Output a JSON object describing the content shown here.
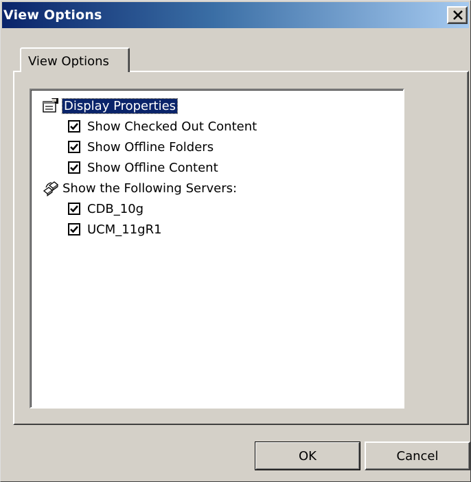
{
  "window": {
    "title": "View Options",
    "close_glyph": "✕"
  },
  "tabs": [
    {
      "label": "View Options",
      "active": true
    }
  ],
  "tree": {
    "display_properties": {
      "label": "Display Properties",
      "icon": "properties-icon",
      "selected": true,
      "items": [
        {
          "label": "Show Checked Out Content",
          "checked": true
        },
        {
          "label": "Show Offline Folders",
          "checked": true
        },
        {
          "label": "Show Offline Content",
          "checked": true
        }
      ]
    },
    "servers": {
      "label": "Show the Following Servers:",
      "icon": "servers-icon",
      "items": [
        {
          "label": "CDB_10g",
          "checked": true
        },
        {
          "label": "UCM_11gR1",
          "checked": true
        }
      ]
    }
  },
  "buttons": {
    "ok": "OK",
    "cancel": "Cancel"
  },
  "colors": {
    "face": "#d4d0c8",
    "title_start": "#0a246a",
    "title_end": "#a6caf0",
    "selection": "#0a246a"
  }
}
